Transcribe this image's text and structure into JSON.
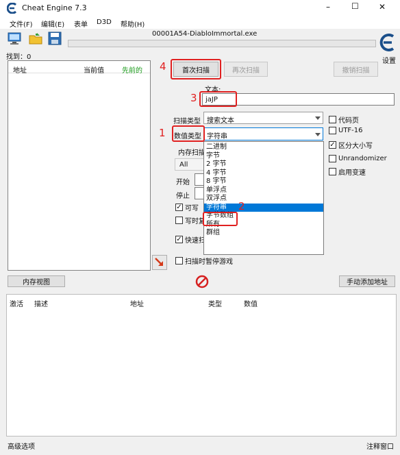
{
  "window": {
    "title": "Cheat Engine 7.3",
    "controls": {
      "minimize": "–",
      "maximize": "☐",
      "close": "✕"
    }
  },
  "menu": [
    "文件(F)",
    "编辑(E)",
    "表单",
    "D3D",
    "帮助(H)"
  ],
  "process_name": "00001A54-DiabloImmortal.exe",
  "settings_label": "设置",
  "found_label": "找到：0",
  "result_columns": [
    "地址",
    "当前值",
    "先前的"
  ],
  "buttons": {
    "first_scan": "首次扫描",
    "next_scan": "再次扫描",
    "undo_scan": "撤销扫描",
    "memory_view": "内存视图",
    "add_address": "手动添加地址"
  },
  "text_label": "文本:",
  "search_value": "jaJP",
  "scan_type_label": "扫描类型",
  "scan_type_value": "搜索文本",
  "value_type_label": "数值类型",
  "value_type_value": "字符串",
  "value_type_options": [
    "二进制",
    "字节",
    "2 字节",
    "4 字节",
    "8 字节",
    "单浮点",
    "双浮点",
    "字符串",
    "字节数组",
    "所有",
    "群组"
  ],
  "value_type_selected_index": 7,
  "memory_scan_label": "内存扫描",
  "memory_region_value": "All",
  "start_label": "开始",
  "stop_label": "停止",
  "writable_label": "可写",
  "copy_on_write_label": "写时复",
  "fast_scan_label": "快速扫",
  "pause_game_label": "扫描时暂停游戏",
  "options": {
    "codepage": "代码页",
    "utf16": "UTF-16",
    "case_sensitive": "区分大小写",
    "unrandomizer": "Unrandomizer",
    "speedhack": "启用变速"
  },
  "address_columns": [
    "激活",
    "描述",
    "地址",
    "类型",
    "数值"
  ],
  "footer": {
    "advanced": "高级选项",
    "comments": "注释窗口"
  },
  "annotations": [
    "1",
    "2",
    "3",
    "4"
  ],
  "colors": {
    "accent_red": "#e02020",
    "selection_blue": "#0078d7",
    "logo_blue": "#1b4f8a"
  }
}
